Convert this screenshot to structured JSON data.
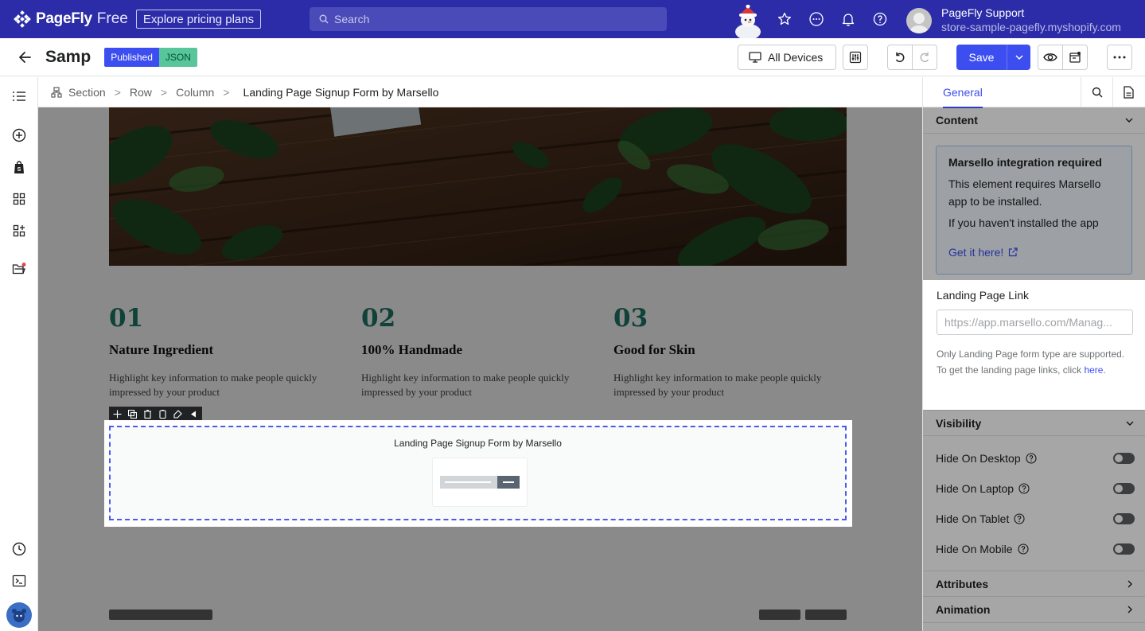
{
  "topbar": {
    "brand": "PageFly",
    "plan": "Free",
    "explore_label": "Explore pricing plans",
    "search_placeholder": "Search",
    "user_name": "PageFly Support",
    "user_store": "store-sample-pagefly.myshopify.com",
    "icons": [
      "star-icon",
      "chat-icon",
      "bell-icon",
      "help-icon"
    ]
  },
  "editor": {
    "page_title": "Samp",
    "status_badge": "Published",
    "json_badge": "JSON",
    "devices_label": "All Devices",
    "save_label": "Save"
  },
  "breadcrumb": {
    "items": [
      "Section",
      "Row",
      "Column"
    ],
    "current": "Landing Page Signup Form by Marsello"
  },
  "canvas": {
    "features": [
      {
        "num": "01",
        "title": "Nature Ingredient",
        "desc": "Highlight key information to make people quickly impressed by your product"
      },
      {
        "num": "02",
        "title": "100% Handmade",
        "desc": "Highlight key information to make people quickly impressed by your product"
      },
      {
        "num": "03",
        "title": "Good for Skin",
        "desc": "Highlight key information to make people quickly impressed by your product"
      }
    ],
    "form_title": "Landing Page Signup Form by Marsello"
  },
  "panel": {
    "tab_general": "General",
    "content_section": "Content",
    "info_title": "Marsello integration required",
    "info_body": "This element requires Marsello app to be installed.",
    "info_body2": "If you haven't installed the app",
    "info_link": "Get it here!",
    "landing_label": "Landing Page Link",
    "landing_placeholder": "https://app.marsello.com/Manag...",
    "help_text": "Only Landing Page form type are supported. To get the landing page links, click ",
    "help_link": "here",
    "help_end": ".",
    "visibility_section": "Visibility",
    "visibility": [
      {
        "label": "Hide On Desktop",
        "on": false
      },
      {
        "label": "Hide On Laptop",
        "on": false
      },
      {
        "label": "Hide On Tablet",
        "on": false
      },
      {
        "label": "Hide On Mobile",
        "on": false
      }
    ],
    "attributes_section": "Attributes",
    "animation_section": "Animation"
  },
  "colors": {
    "topbar": "#2c2ca8",
    "accent": "#3d4ef0",
    "published": "#3d4ef0",
    "json": "#58c59b",
    "feature_number": "#1f7a6a"
  }
}
